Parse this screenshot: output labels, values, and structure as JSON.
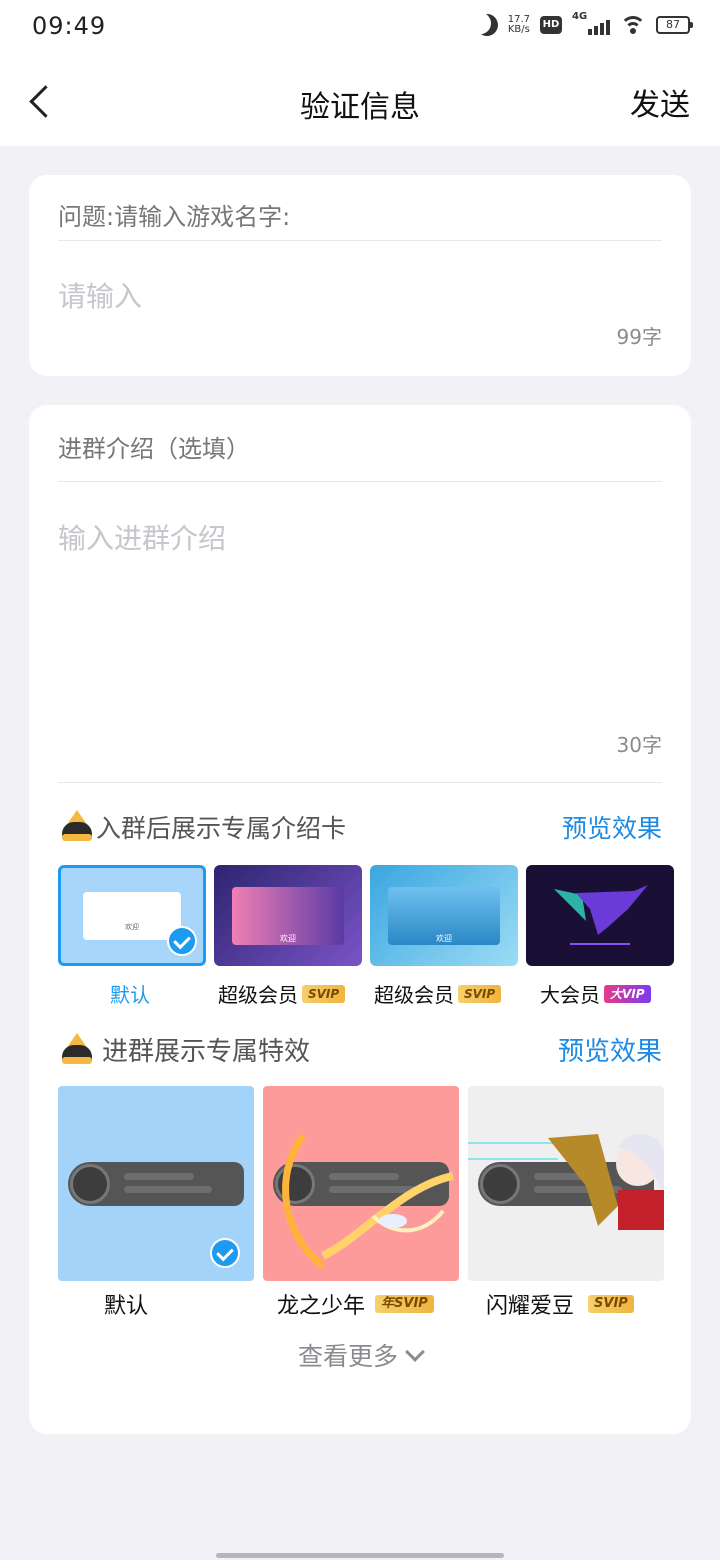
{
  "status_bar": {
    "time": "09:49",
    "speed_value": "17.7",
    "speed_unit": "KB/s",
    "network": "4G",
    "hd": "HD",
    "battery": "87"
  },
  "nav": {
    "title": "验证信息",
    "send": "发送"
  },
  "question": {
    "label": "问题:请输入游戏名字:",
    "placeholder": "请输入",
    "counter": "99字"
  },
  "intro": {
    "label": "进群介绍（选填）",
    "placeholder": "输入进群介绍",
    "counter": "30字"
  },
  "intro_cards": {
    "title": "入群后展示专属介绍卡",
    "preview": "预览效果",
    "items": [
      {
        "label": "默认",
        "badge": "",
        "selected": true,
        "card_text": "欢迎"
      },
      {
        "label": "超级会员",
        "badge": "SVIP",
        "selected": false,
        "card_text": "欢迎"
      },
      {
        "label": "超级会员",
        "badge": "SVIP",
        "selected": false,
        "card_text": "欢迎"
      },
      {
        "label": "大会员",
        "badge": "大VIP",
        "selected": false,
        "card_text": ""
      }
    ]
  },
  "effects": {
    "title": "进群展示专属特效",
    "preview": "预览效果",
    "items": [
      {
        "label": "默认",
        "badge": "",
        "selected": true,
        "bg": "#a3d3f8"
      },
      {
        "label": "龙之少年",
        "badge": "年SVIP",
        "selected": false,
        "bg": "#fd9b9b"
      },
      {
        "label": "闪耀爱豆",
        "badge": "SVIP",
        "selected": false,
        "bg": "#efefef"
      }
    ],
    "more": "查看更多"
  }
}
